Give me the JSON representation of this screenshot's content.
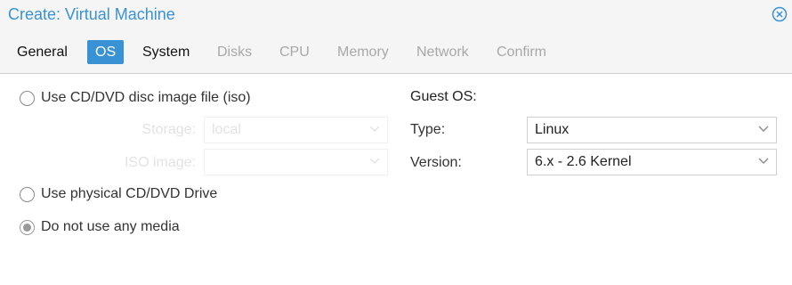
{
  "window": {
    "title": "Create: Virtual Machine",
    "close_icon": "close-circle-icon"
  },
  "tabs": [
    {
      "label": "General",
      "state": "enabled"
    },
    {
      "label": "OS",
      "state": "active"
    },
    {
      "label": "System",
      "state": "enabled"
    },
    {
      "label": "Disks",
      "state": "disabled"
    },
    {
      "label": "CPU",
      "state": "disabled"
    },
    {
      "label": "Memory",
      "state": "disabled"
    },
    {
      "label": "Network",
      "state": "disabled"
    },
    {
      "label": "Confirm",
      "state": "disabled"
    }
  ],
  "media": {
    "iso_option": "Use CD/DVD disc image file (iso)",
    "storage_label": "Storage:",
    "storage_value": "local",
    "iso_image_label": "ISO image:",
    "iso_image_value": "",
    "physical_option": "Use physical CD/DVD Drive",
    "none_option": "Do not use any media",
    "selected": "none"
  },
  "guest_os": {
    "heading": "Guest OS:",
    "type_label": "Type:",
    "type_value": "Linux",
    "version_label": "Version:",
    "version_value": "6.x - 2.6 Kernel"
  },
  "colors": {
    "accent": "#3892d4",
    "disabled_text": "#a8a8a8",
    "header_bg": "#f5f5f5"
  }
}
